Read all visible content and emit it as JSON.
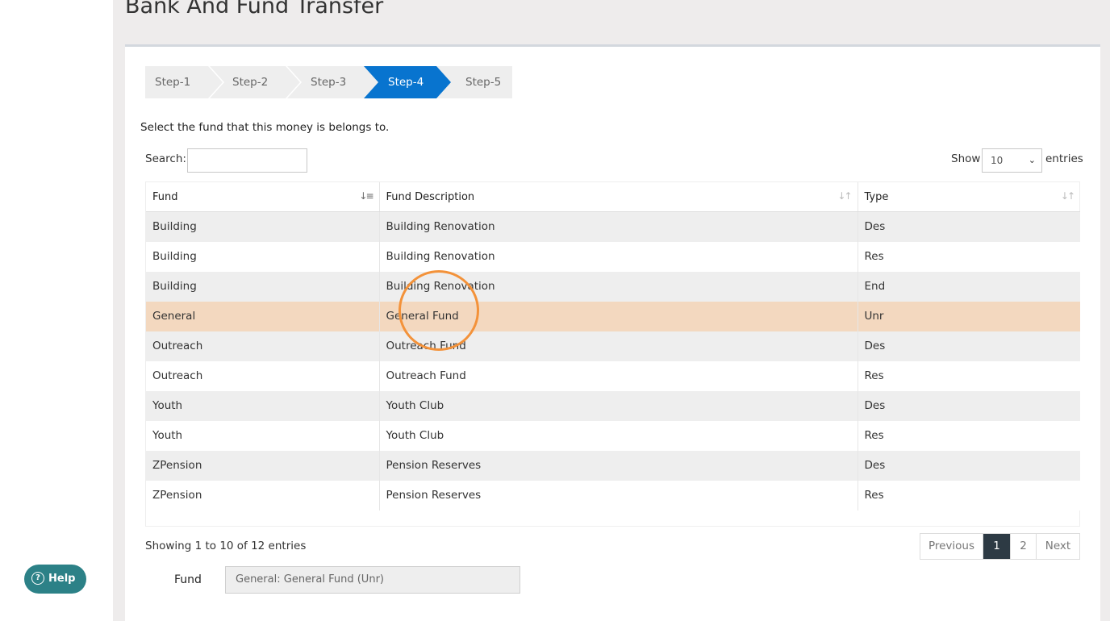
{
  "page_title": "Bank And Fund Transfer",
  "steps": [
    "Step-1",
    "Step-2",
    "Step-3",
    "Step-4",
    "Step-5"
  ],
  "active_step": "Step-4",
  "instruction": "Select the fund that this money is belongs to.",
  "search": {
    "label": "Search:",
    "value": ""
  },
  "length": {
    "show_label": "Show",
    "selected": "10",
    "entries_label": "entries"
  },
  "columns": [
    "Fund",
    "Fund Description",
    "Type"
  ],
  "rows": [
    [
      "Building",
      "Building Renovation",
      "Des"
    ],
    [
      "Building",
      "Building Renovation",
      "Res"
    ],
    [
      "Building",
      "Building Renovation",
      "End"
    ],
    [
      "General",
      "General Fund",
      "Unr"
    ],
    [
      "Outreach",
      "Outreach Fund",
      "Des"
    ],
    [
      "Outreach",
      "Outreach Fund",
      "Res"
    ],
    [
      "Youth",
      "Youth Club",
      "Des"
    ],
    [
      "Youth",
      "Youth Club",
      "Res"
    ],
    [
      "ZPension",
      "Pension Reserves",
      "Des"
    ],
    [
      "ZPension",
      "Pension Reserves",
      "Res"
    ]
  ],
  "selected_row": 4,
  "info": "Showing 1 to 10 of 12 entries",
  "pagination": {
    "previous": "Previous",
    "pages": [
      "1",
      "2"
    ],
    "current": "1",
    "next": "Next"
  },
  "fund_field": {
    "label": "Fund",
    "value": "General: General Fund (Unr)"
  },
  "help_button": "Help",
  "colors": {
    "accent": "#0874cf",
    "selected_row": "#f3d8bf",
    "help": "#2c8187",
    "pagination_active": "#2d3a44",
    "cursor_highlight": "#f3923a"
  }
}
